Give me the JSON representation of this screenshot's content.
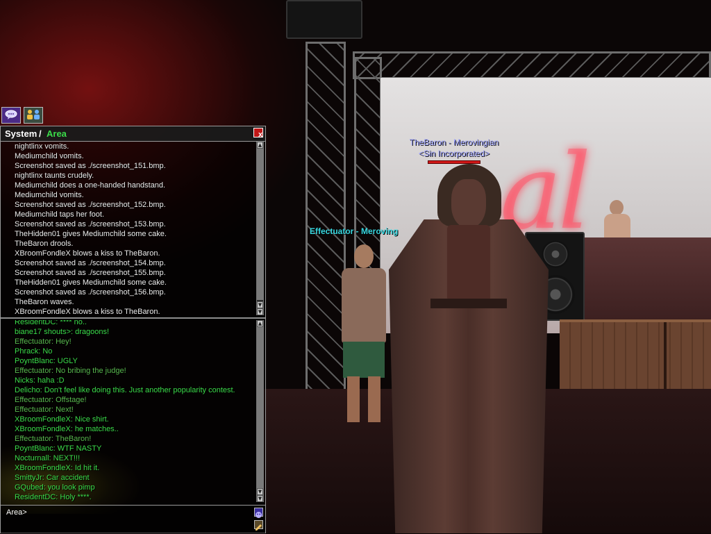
{
  "nameplates": {
    "baron_line1": "TheBaron - Merovingian",
    "baron_line2": "<Sin Incorporated>",
    "effectuator": "Effectuator - Meroving"
  },
  "chat": {
    "title_system": "System",
    "title_separator": "/",
    "title_area": "Area",
    "close_label": "x",
    "input_prefix": "Area>",
    "system_lines": [
      "nightlinx vomits.",
      "Mediumchild vomits.",
      "Screenshot saved as ./screenshot_151.bmp.",
      "nightlinx taunts crudely.",
      "Mediumchild does a one-handed handstand.",
      "Mediumchild vomits.",
      "Screenshot saved as ./screenshot_152.bmp.",
      "Mediumchild taps her foot.",
      "Screenshot saved as ./screenshot_153.bmp.",
      "TheHidden01 gives Mediumchild some cake.",
      "TheBaron drools.",
      "XBroomFondleX blows a kiss to TheBaron.",
      "Screenshot saved as ./screenshot_154.bmp.",
      "Screenshot saved as ./screenshot_155.bmp.",
      "TheHidden01 gives Mediumchild some cake.",
      "Screenshot saved as ./screenshot_156.bmp.",
      "TheBaron waves.",
      "XBroomFondleX blows a kiss to TheBaron."
    ],
    "area_lines": [
      {
        "text": "ResidentDC: **** no..",
        "color": "#3bdc4a"
      },
      {
        "text": "biane17 shouts>: dragoons!",
        "color": "#3bdc4a"
      },
      {
        "text": "Effectuator: Hey!",
        "color": "#58b84e"
      },
      {
        "text": "Phrack: No",
        "color": "#3bdc4a"
      },
      {
        "text": "PoyntBlanc: UGLY",
        "color": "#3bdc4a"
      },
      {
        "text": "Effectuator: No bribing the judge!",
        "color": "#58b84e"
      },
      {
        "text": "Nicks: haha :D",
        "color": "#3bdc4a"
      },
      {
        "text": "Delicho: Don't feel like doing this.  Just another popularity contest.",
        "color": "#3bdc4a"
      },
      {
        "text": "Effectuator: Offstage!",
        "color": "#58b84e"
      },
      {
        "text": "Effectuator: Next!",
        "color": "#58b84e"
      },
      {
        "text": "XBroomFondleX: Nice shirt.",
        "color": "#3bdc4a"
      },
      {
        "text": "XBroomFondleX: he matches..",
        "color": "#3bdc4a"
      },
      {
        "text": "Effectuator: TheBaron!",
        "color": "#58b84e"
      },
      {
        "text": "PoyntBlanc: WTF NASTY",
        "color": "#3bdc4a"
      },
      {
        "text": "Nocturnall: NEXT!!!",
        "color": "#3bdc4a"
      },
      {
        "text": "XBroomFondleX: Id hit it.",
        "color": "#3bdc4a"
      },
      {
        "text": "SmittyJr: Car accident",
        "color": "#3bdc4a"
      },
      {
        "text": "GQubed: you look pimp",
        "color": "#3bdc4a"
      },
      {
        "text": "ResidentDC: Holy ****.",
        "color": "#3bdc4a"
      }
    ]
  },
  "icons": {
    "tab_chat": "speech-bubble-icon",
    "tab_social": "people-icon",
    "emote_button": "mask-icon",
    "settings_button": "pencil-icon"
  },
  "colors": {
    "area_text": "#3bdc4a",
    "system_text": "#ececec",
    "baron_name": "#9aa0ff",
    "effectuator_name": "#37d7e0"
  }
}
